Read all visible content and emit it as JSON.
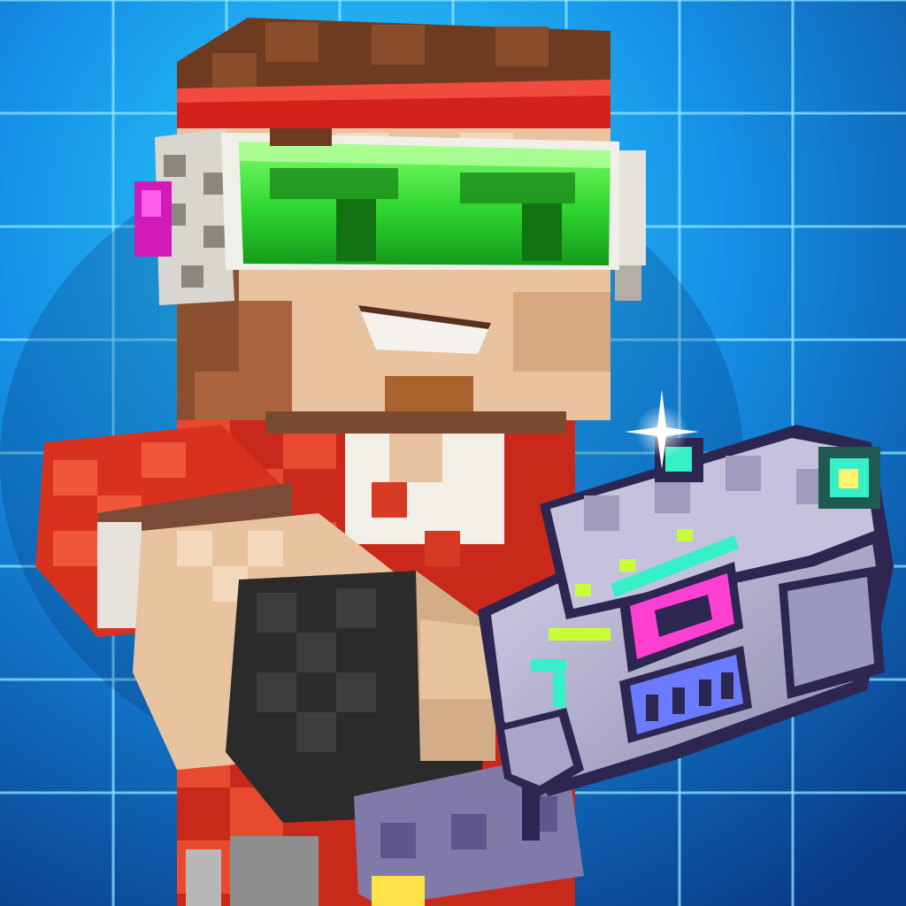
{
  "scene": {
    "subject": "blocky-character-with-blaster",
    "colors": {
      "background_top": "#1ec4ff",
      "background_bottom": "#0a3f8c",
      "grid_line": "#8fe6ff",
      "hair": "#7a3f22",
      "headband": "#d8261f",
      "goggles": "#39e13a",
      "skin": "#e9c29f",
      "shirt": "#e23b24",
      "glove": "#2a2a2a",
      "gun_body": "#b8b6d2",
      "gun_neon_pink": "#ff3fd2",
      "gun_neon_green": "#b8ff3a",
      "gun_neon_cyan": "#36f0c8"
    }
  }
}
